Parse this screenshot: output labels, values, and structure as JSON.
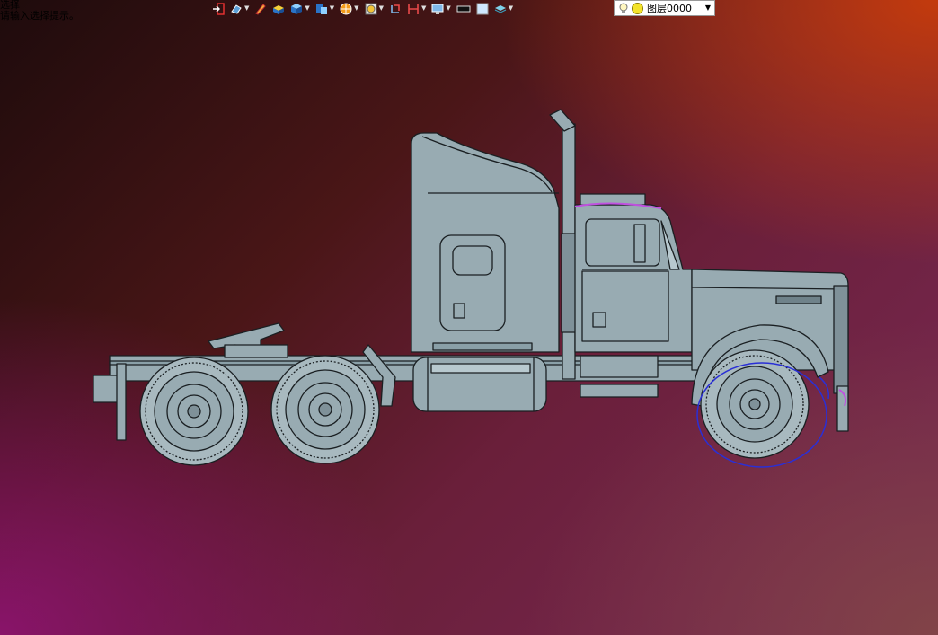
{
  "command_prompt": {
    "line1": "选择",
    "line2": "请输入选择提示。"
  },
  "toolbar": {
    "items": [
      {
        "name": "exit-icon",
        "dropdown": false
      },
      {
        "name": "view-orient-icon",
        "dropdown": true
      },
      {
        "name": "pencil-icon",
        "dropdown": false
      },
      {
        "name": "render-shaded-icon",
        "dropdown": false
      },
      {
        "name": "cube-view-icon",
        "dropdown": true
      },
      {
        "name": "section-view-icon",
        "dropdown": true
      },
      {
        "name": "snap-icon",
        "dropdown": true
      },
      {
        "name": "zoom-icon",
        "dropdown": true
      },
      {
        "name": "rotate-icon",
        "dropdown": false
      },
      {
        "name": "measure-icon",
        "dropdown": true
      },
      {
        "name": "display-icon",
        "dropdown": true
      },
      {
        "name": "color-black-icon",
        "dropdown": false
      },
      {
        "name": "color-light-icon",
        "dropdown": false
      },
      {
        "name": "layer-stack-icon",
        "dropdown": true
      }
    ]
  },
  "layer_selector": {
    "value": "图层0000",
    "bulb_icon": "bulb-icon",
    "sun_icon": "visible-sun-icon",
    "arrow_icon": "dropdown-arrow-icon"
  },
  "colors": {
    "body": "#98abb2",
    "outline": "#1a1f22",
    "highlight_blue": "#2a2fd6",
    "highlight_magenta": "#c050e0",
    "layer_sun": "#f3e32a"
  }
}
